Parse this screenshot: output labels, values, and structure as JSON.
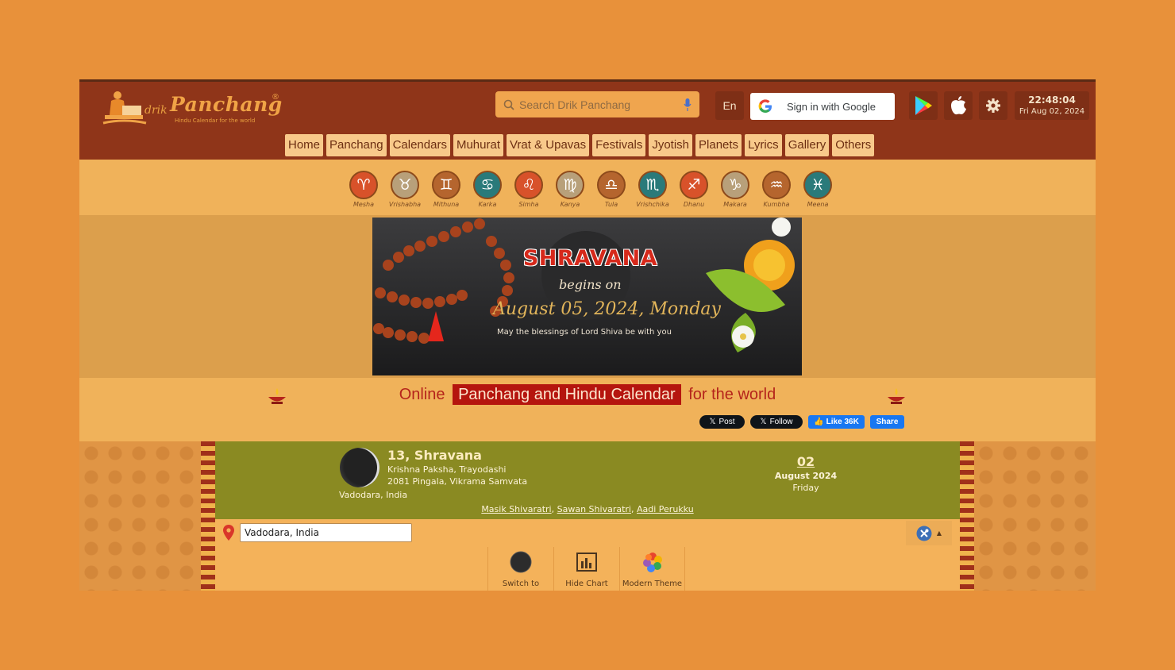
{
  "header": {
    "brand_small": "drik",
    "brand_big": "Panchang",
    "brand_reg": "®",
    "brand_tagline": "Hindu Calendar for the world",
    "search_placeholder": "Search Drik Panchang",
    "lang_label": "En",
    "google_label": "Sign in with Google",
    "clock_time": "22:48:04",
    "clock_date": "Fri Aug 02, 2024"
  },
  "nav": [
    "Home",
    "Panchang",
    "Calendars",
    "Muhurat",
    "Vrat & Upavas",
    "Festivals",
    "Jyotish",
    "Planets",
    "Lyrics",
    "Gallery",
    "Others"
  ],
  "zodiac": [
    {
      "name": "Mesha",
      "glyph": "♈",
      "color": "#d8522a"
    },
    {
      "name": "Vrishabha",
      "glyph": "♉",
      "color": "#b8a07a"
    },
    {
      "name": "Mithuna",
      "glyph": "♊",
      "color": "#b5652e"
    },
    {
      "name": "Karka",
      "glyph": "♋",
      "color": "#2a7a7a"
    },
    {
      "name": "Simha",
      "glyph": "♌",
      "color": "#d8522a"
    },
    {
      "name": "Kanya",
      "glyph": "♍",
      "color": "#b8a07a"
    },
    {
      "name": "Tula",
      "glyph": "♎",
      "color": "#b5652e"
    },
    {
      "name": "Vrishchika",
      "glyph": "♏",
      "color": "#2a7a7a"
    },
    {
      "name": "Dhanu",
      "glyph": "♐",
      "color": "#d8522a"
    },
    {
      "name": "Makara",
      "glyph": "♑",
      "color": "#b8a07a"
    },
    {
      "name": "Kumbha",
      "glyph": "♒",
      "color": "#b5652e"
    },
    {
      "name": "Meena",
      "glyph": "♓",
      "color": "#2a7a7a"
    }
  ],
  "banner": {
    "title": "SHRAVANA",
    "sub": "begins on",
    "date": "August 05, 2024, Monday",
    "blessing": "May  the blessings of Lord Shiva be with you"
  },
  "tagline": {
    "pre": "Online",
    "highlight": "Panchang and Hindu Calendar",
    "post": "for the world"
  },
  "social": {
    "x_post": "Post",
    "x_follow": "Follow",
    "fb_like": "Like 36K",
    "fb_share": "Share"
  },
  "day": {
    "tithi_title": "13, Shravana",
    "paksha": "Krishna Paksha, Trayodashi",
    "samvata": "2081 Pingala, Vikrama Samvata",
    "location": "Vadodara, India",
    "date_day": "02",
    "date_month": "August 2024",
    "date_dow": "Friday",
    "festivals": [
      "Masik Shivaratri",
      "Sawan Shivaratri",
      "Aadi Perukku"
    ]
  },
  "location_input": {
    "value": "Vadodara, India"
  },
  "tools": [
    "Switch to",
    "Hide Chart",
    "Modern Theme"
  ],
  "colors": {
    "page_bg": "#e8913a",
    "header_bg": "#8f3519",
    "accent_red": "#b5150e",
    "daybar_olive": "#8a8a22"
  }
}
